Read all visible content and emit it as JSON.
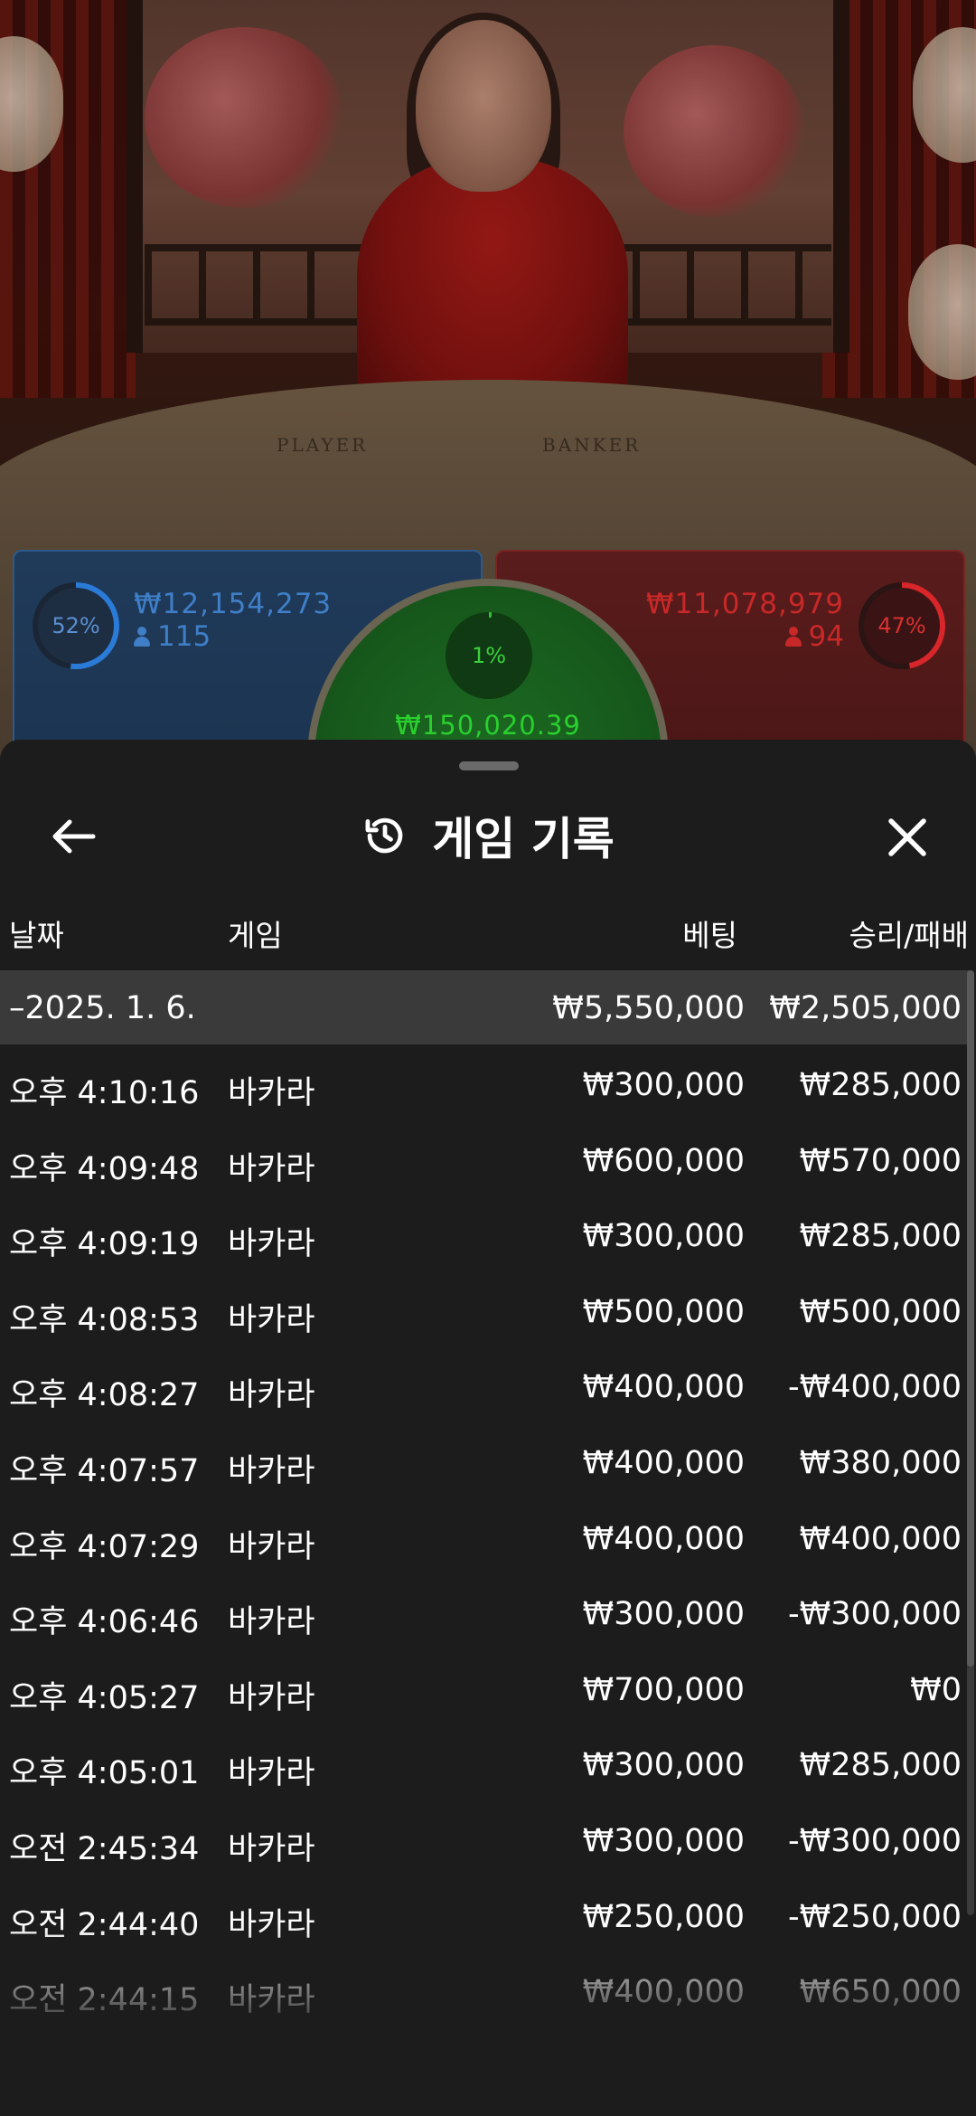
{
  "live_table": {
    "table_labels": {
      "player": "PLAYER",
      "banker": "BANKER"
    },
    "player": {
      "percent": "52%",
      "percent_value": 52,
      "amount": "₩12,154,273",
      "players": "115",
      "color": "#2a7bd8"
    },
    "tie": {
      "percent": "1%",
      "percent_value": 1,
      "amount": "₩150,020.39",
      "color": "#34c038"
    },
    "banker": {
      "percent": "47%",
      "percent_value": 47,
      "amount": "₩11,078,979",
      "players": "94",
      "color": "#d8262a"
    }
  },
  "history": {
    "title": "게임 기록",
    "icons": {
      "back": "arrow-left-icon",
      "title": "history-icon",
      "close": "close-icon"
    },
    "columns": {
      "date": "날짜",
      "game": "게임",
      "bet": "베팅",
      "win_loss": "승리/패배"
    },
    "summary": {
      "date": "–2025. 1. 6.",
      "bet": "₩5,550,000",
      "win_loss": "₩2,505,000"
    },
    "rows": [
      {
        "time": "오후 4:10:16",
        "game": "바카라",
        "bet": "₩300,000",
        "win_loss": "₩285,000"
      },
      {
        "time": "오후 4:09:48",
        "game": "바카라",
        "bet": "₩600,000",
        "win_loss": "₩570,000"
      },
      {
        "time": "오후 4:09:19",
        "game": "바카라",
        "bet": "₩300,000",
        "win_loss": "₩285,000"
      },
      {
        "time": "오후 4:08:53",
        "game": "바카라",
        "bet": "₩500,000",
        "win_loss": "₩500,000"
      },
      {
        "time": "오후 4:08:27",
        "game": "바카라",
        "bet": "₩400,000",
        "win_loss": "-₩400,000"
      },
      {
        "time": "오후 4:07:57",
        "game": "바카라",
        "bet": "₩400,000",
        "win_loss": "₩380,000"
      },
      {
        "time": "오후 4:07:29",
        "game": "바카라",
        "bet": "₩400,000",
        "win_loss": "₩400,000"
      },
      {
        "time": "오후 4:06:46",
        "game": "바카라",
        "bet": "₩300,000",
        "win_loss": "-₩300,000"
      },
      {
        "time": "오후 4:05:27",
        "game": "바카라",
        "bet": "₩700,000",
        "win_loss": "₩0"
      },
      {
        "time": "오후 4:05:01",
        "game": "바카라",
        "bet": "₩300,000",
        "win_loss": "₩285,000"
      },
      {
        "time": "오전 2:45:34",
        "game": "바카라",
        "bet": "₩300,000",
        "win_loss": "-₩300,000"
      },
      {
        "time": "오전 2:44:40",
        "game": "바카라",
        "bet": "₩250,000",
        "win_loss": "-₩250,000"
      },
      {
        "time": "오전 2:44:15",
        "game": "바카라",
        "bet": "₩400,000",
        "win_loss": "₩650,000"
      }
    ]
  }
}
